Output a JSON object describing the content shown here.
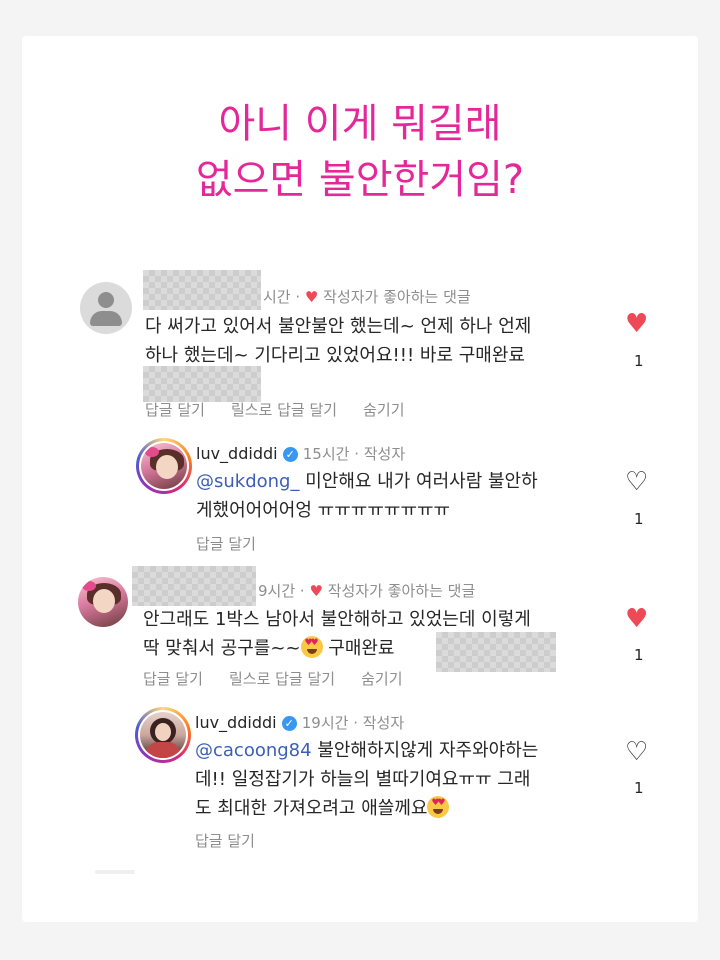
{
  "headline": {
    "line1": "아니 이게 뭐길래",
    "line2": "없으면 불안한거임?"
  },
  "comments": [
    {
      "time": "시간 ·",
      "liked_by_author": "작성자가 좋아하는 댓글",
      "text_line1": "다 써가고 있어서 불안불안 했는데~ 언제 하나 언제",
      "text_line2": "하나 했는데~ 기다리고 있었어요!!! 바로 구매완료",
      "actions": [
        "답글 달기",
        "릴스로 답글 달기",
        "숨기기"
      ],
      "like_count": "1",
      "reply": {
        "username": "luv_ddiddi",
        "verified_icon": "✓",
        "meta": "15시간 · 작성자",
        "mention": "@sukdong_",
        "text_line1": " 미안해요 내가 여러사람 불안하",
        "text_line2": "게했어어어어엉 ㅠㅠㅠㅠㅠㅠㅠㅠ",
        "action": "답글 달기",
        "like_count": "1"
      }
    },
    {
      "time": "9시간 ·",
      "liked_by_author": "작성자가 좋아하는 댓글",
      "text_line1": "안그래도 1박스 남아서 불안해하고 있었는데 이렇게",
      "text_line2": "딱 맞춰서 공구를~~",
      "text_line2b": " 구매완료",
      "actions": [
        "답글 달기",
        "릴스로 답글 달기",
        "숨기기"
      ],
      "like_count": "1",
      "reply": {
        "username": "luv_ddiddi",
        "verified_icon": "✓",
        "meta": "19시간 · 작성자",
        "mention": "@cacoong84",
        "text_line1": " 불안해하지않게 자주와야하는",
        "text_line2": "데!! 일정잡기가 하늘의 별따기여요ㅠㅠ 그래",
        "text_line3": "도 최대한 가져오려고 애쓸께요",
        "action": "답글 달기",
        "like_count": "1"
      }
    }
  ],
  "icons": {
    "heart_filled": "♥",
    "heart_outline": "♡",
    "liked_heart": "♥"
  },
  "colors": {
    "headline": "#e4289a",
    "like": "#ed4956",
    "mention": "#3b5fb8",
    "verified": "#3897f0"
  }
}
